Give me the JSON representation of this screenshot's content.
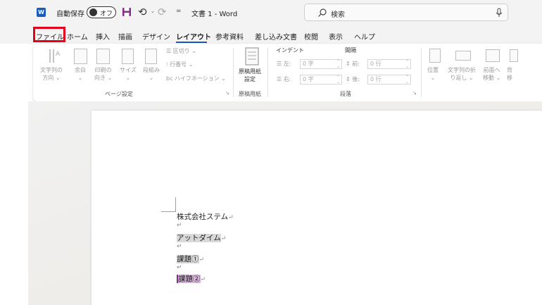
{
  "titlebar": {
    "autosave_label": "自動保存",
    "autosave_state": "オフ",
    "document_title": "文書 1 - Word",
    "search_text": "検索",
    "qa_more": "="
  },
  "tabs": [
    {
      "label": "ファイル"
    },
    {
      "label": "ホーム"
    },
    {
      "label": "挿入"
    },
    {
      "label": "描画"
    },
    {
      "label": "デザイン"
    },
    {
      "label": "レイアウト"
    },
    {
      "label": "参考資料"
    },
    {
      "label": "差し込み文書"
    },
    {
      "label": "校閲"
    },
    {
      "label": "表示"
    },
    {
      "label": "ヘルプ"
    }
  ],
  "active_tab": "レイアウト",
  "ribbon": {
    "page_setup": {
      "group_name": "ページ設定",
      "text_direction": [
        "文字列の",
        "方向 ⌄"
      ],
      "margins": [
        "余白",
        "⌄"
      ],
      "orientation": [
        "印刷の",
        "向き ⌄"
      ],
      "size": [
        "サイズ",
        "⌄"
      ],
      "columns": [
        "段組み",
        "⌄"
      ],
      "breaks": "区切り ⌄",
      "line_numbers": "行番号 ⌄",
      "hyphenation": "ハイフネーション ⌄"
    },
    "genko": {
      "group_name": "原稿用紙",
      "button": [
        "原稿用紙",
        "設定"
      ]
    },
    "paragraph": {
      "group_name": "段落",
      "indent_heading": "インデント",
      "spacing_heading": "間隔",
      "indent_left_label": "左:",
      "indent_left_value": "0 字",
      "indent_right_label": "右:",
      "indent_right_value": "0 字",
      "space_before_label": "前:",
      "space_before_value": "0 行",
      "space_after_label": "後:",
      "space_after_value": "0 行"
    },
    "arrange": {
      "position": [
        "位置",
        "⌄"
      ],
      "wrap_text": [
        "文字列の折",
        "り返し ⌄"
      ],
      "bring_forward": [
        "前面へ",
        "移動 ⌄"
      ],
      "send_backward": [
        "背",
        "移"
      ]
    }
  },
  "document": {
    "lines": [
      {
        "text": "株式会社ステム",
        "mark": "↵",
        "style": "none"
      },
      {
        "text": "",
        "mark": "↵",
        "style": "none"
      },
      {
        "text": "アットダイム",
        "mark": "↵",
        "style": "gray"
      },
      {
        "text": "",
        "mark": "↵",
        "style": "none"
      },
      {
        "text": "課題①",
        "mark": "↵",
        "style": "gray"
      },
      {
        "text": "",
        "mark": "↵",
        "style": "none"
      },
      {
        "text": "課題②",
        "mark": "↵",
        "style": "purple"
      }
    ]
  },
  "colors": {
    "accent": "#185abd",
    "highlight_box": "#e4001b",
    "selection_purple": "#d7b4d9"
  }
}
